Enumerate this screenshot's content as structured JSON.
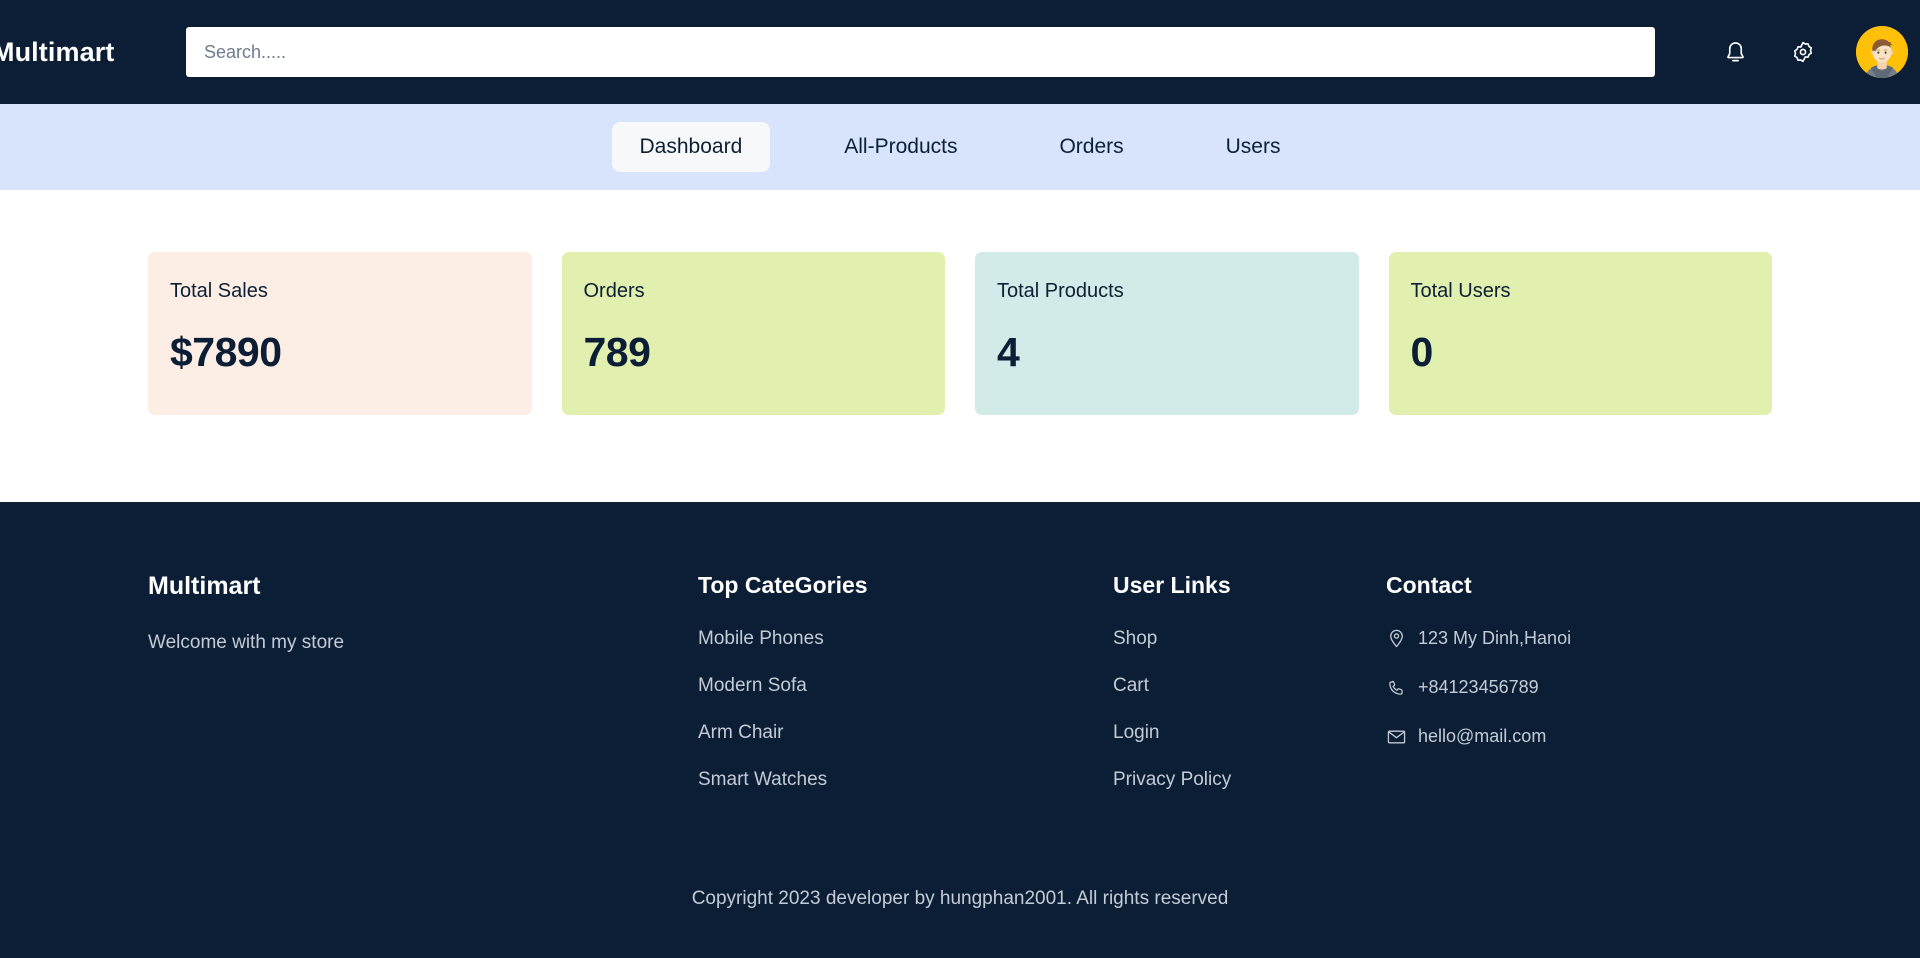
{
  "header": {
    "brand": "Multimart",
    "search": {
      "placeholder": "Search.....",
      "value": ""
    },
    "icons": {
      "notification": "bell-icon",
      "settings": "gear-icon",
      "avatar": "user-avatar"
    }
  },
  "nav": {
    "items": [
      {
        "label": "Dashboard",
        "active": true
      },
      {
        "label": "All-Products",
        "active": false
      },
      {
        "label": "Orders",
        "active": false
      },
      {
        "label": "Users",
        "active": false
      }
    ]
  },
  "stats": [
    {
      "title": "Total Sales",
      "value": "$7890",
      "bg": "#fceee4"
    },
    {
      "title": "Orders",
      "value": "789",
      "bg": "#e1efaf"
    },
    {
      "title": "Total Products",
      "value": "4",
      "bg": "#d2eae8"
    },
    {
      "title": "Total Users",
      "value": "0",
      "bg": "#e1efaf"
    }
  ],
  "footer": {
    "brand": {
      "heading": "Multimart",
      "description": "Welcome with my store"
    },
    "categories": {
      "heading": "Top CateGories",
      "items": [
        "Mobile Phones",
        "Modern Sofa",
        "Arm Chair",
        "Smart Watches"
      ]
    },
    "user_links": {
      "heading": "User Links",
      "items": [
        "Shop",
        "Cart",
        "Login",
        "Privacy Policy"
      ]
    },
    "contact": {
      "heading": "Contact",
      "items": [
        {
          "icon": "location-pin-icon",
          "text": "123 My Dinh,Hanoi"
        },
        {
          "icon": "phone-icon",
          "text": "+84123456789"
        },
        {
          "icon": "envelope-icon",
          "text": "hello@mail.com"
        }
      ]
    },
    "copyright": "Copyright 2023 developer by hungphan2001. All rights reserved"
  },
  "colors": {
    "dark_navy": "#0c1e35",
    "nav_blue": "#d8e4fb",
    "active_tab": "#f7f8f9",
    "avatar_yellow": "#ffc107",
    "muted_text": "#c3cbd6"
  }
}
